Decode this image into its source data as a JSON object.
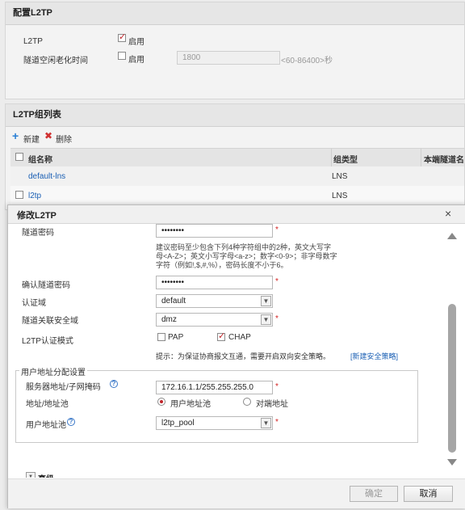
{
  "config_panel": {
    "title": "配置L2TP",
    "l2tp_label": "L2TP",
    "l2tp_enabled": true,
    "enable_label": "启用",
    "idle_label": "隧道空闲老化时间",
    "idle_enabled": false,
    "idle_enable_label": "启用",
    "idle_value": "1800",
    "idle_hint": "<60-86400>秒"
  },
  "group_panel": {
    "title": "L2TP组列表",
    "new_label": "新建",
    "delete_label": "删除",
    "columns": [
      "组名称",
      "组类型",
      "本端隧道名"
    ],
    "rows": [
      {
        "name": "default-lns",
        "type": "LNS"
      },
      {
        "name": "l2tp",
        "type": "LNS"
      }
    ]
  },
  "dialog": {
    "title": "修改L2TP",
    "close": "×",
    "tunnel_pwd_label": "隧道密码",
    "tunnel_pwd_value": "••••••••",
    "pwd_hint_lines": [
      "建议密码至少包含下列4种字符组中的2种，英文大写字",
      "母<A-Z>；英文小写字母<a-z>；数字<0-9>；非字母数字",
      "字符（例如!,$,#,%），密码长度不小于6。"
    ],
    "confirm_pwd_label": "确认隧道密码",
    "confirm_pwd_value": "••••••••",
    "auth_domain_label": "认证域",
    "auth_domain_value": "default",
    "zone_label": "隧道关联安全域",
    "zone_value": "dmz",
    "auth_mode_label": "L2TP认证模式",
    "pap_label": "PAP",
    "pap_checked": false,
    "chap_label": "CHAP",
    "chap_checked": true,
    "policy_hint": "提示：为保证协商报文互通，需要开启双向安全策略。",
    "policy_link": "[新建安全策略]",
    "addr_group_title": "用户地址分配设置",
    "server_addr_label": "服务器地址/子网掩码",
    "server_addr_value": "172.16.1.1/255.255.255.0",
    "addr_pool_label": "地址/地址池",
    "user_pool_option": "用户地址池",
    "peer_addr_option": "对端地址",
    "user_pool_label": "用户地址池",
    "user_pool_value": "l2tp_pool",
    "advanced_label": "高级",
    "ok_label": "确定",
    "cancel_label": "取消",
    "help_glyph": "?"
  }
}
